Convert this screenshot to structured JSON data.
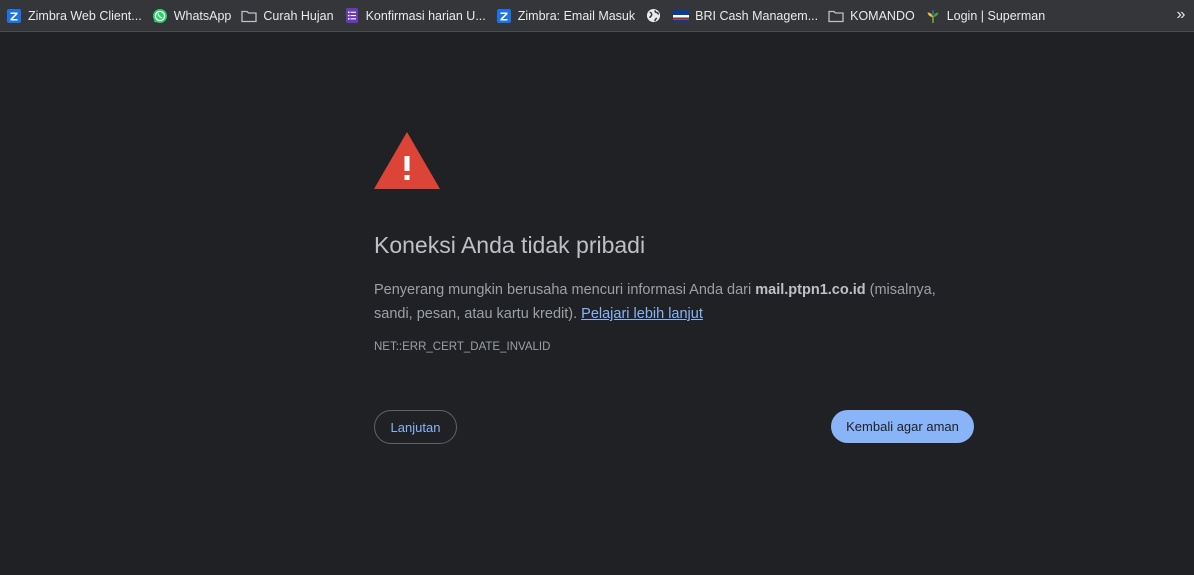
{
  "bookmarks": [
    {
      "label": "Zimbra Web Client...",
      "icon": "zimbra-icon"
    },
    {
      "label": "WhatsApp",
      "icon": "whatsapp-icon"
    },
    {
      "label": "Curah Hujan",
      "icon": "folder-icon"
    },
    {
      "label": "Konfirmasi harian U...",
      "icon": "forms-icon"
    },
    {
      "label": "Zimbra: Email Masuk",
      "icon": "zimbra-icon"
    },
    {
      "label": "",
      "icon": "globe-icon"
    },
    {
      "label": "BRI Cash Managem...",
      "icon": "bri-icon"
    },
    {
      "label": "KOMANDO",
      "icon": "folder-icon"
    },
    {
      "label": "Login | Superman",
      "icon": "plant-logo-icon"
    }
  ],
  "overflow_chevron": "»",
  "interstitial": {
    "title": "Koneksi Anda tidak pribadi",
    "body_prefix": "Penyerang mungkin berusaha mencuri informasi Anda dari ",
    "domain": "mail.ptpn1.co.id",
    "body_suffix": " (misalnya, sandi, pesan, atau kartu kredit). ",
    "learn_more": "Pelajari lebih lanjut",
    "error_code": "NET::ERR_CERT_DATE_INVALID",
    "advanced_button": "Lanjutan",
    "back_button": "Kembali agar aman"
  },
  "colors": {
    "background": "#202124",
    "bookmark_bar": "#35363a",
    "warning_red": "#db4437",
    "link_blue": "#8ab4f8",
    "title_text": "#bdc1c6",
    "body_text": "#9aa0a6"
  }
}
